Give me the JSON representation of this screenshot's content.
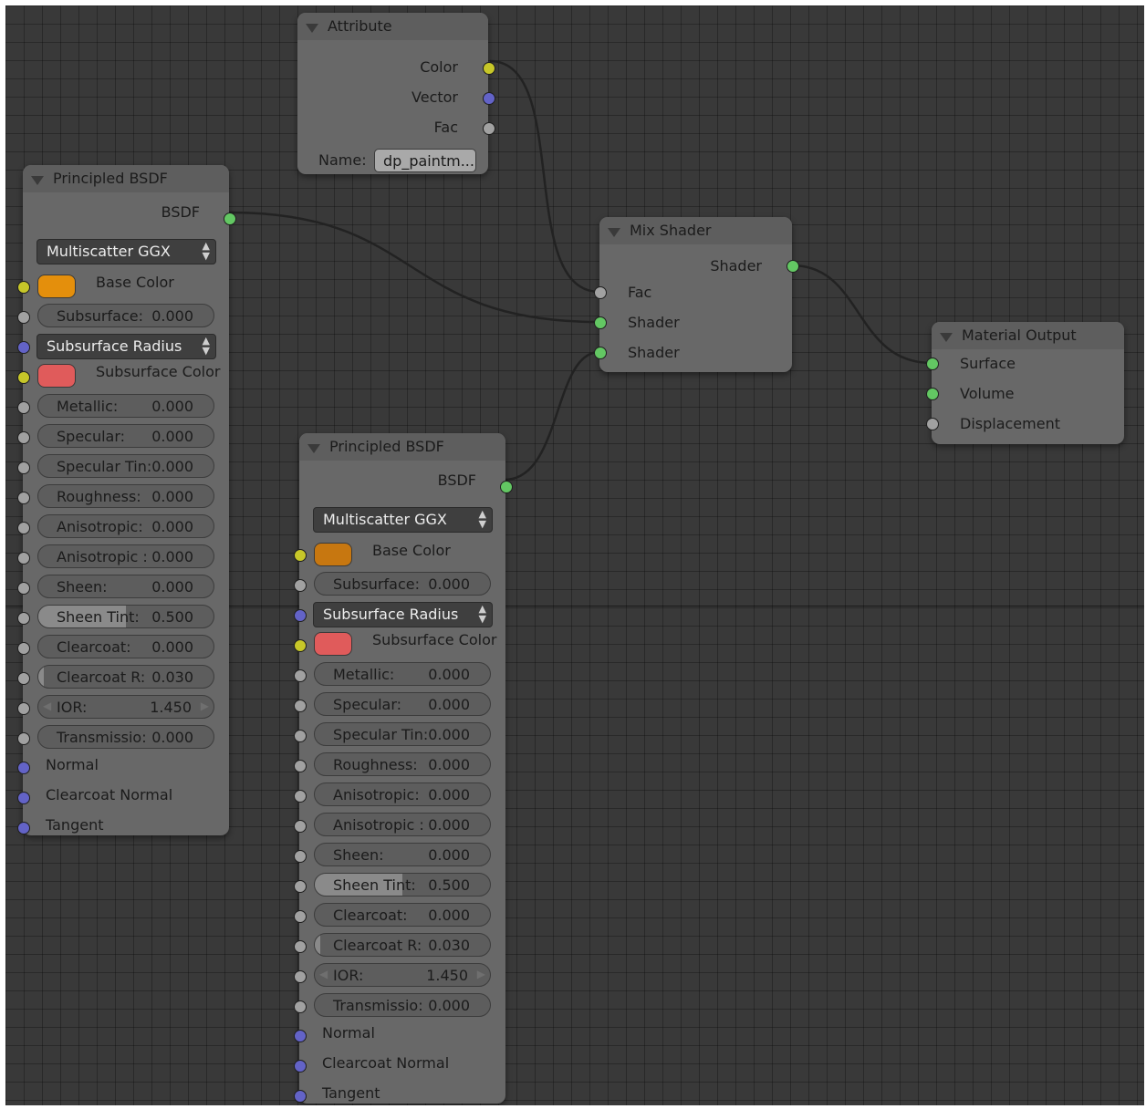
{
  "colors": {
    "background": "#393939",
    "node_body": "#686868",
    "socket_color": "#c7c729",
    "socket_vector": "#6363c7",
    "socket_float": "#a1a1a1",
    "socket_shader": "#63c763"
  },
  "attribute": {
    "title": "Attribute",
    "outputs": [
      "Color",
      "Vector",
      "Fac"
    ],
    "name_label": "Name:",
    "name_value": "dp_paintm..."
  },
  "mix_shader": {
    "title": "Mix Shader",
    "output": "Shader",
    "inputs": [
      "Fac",
      "Shader",
      "Shader"
    ]
  },
  "material_output": {
    "title": "Material Output",
    "inputs": [
      "Surface",
      "Volume",
      "Displacement"
    ]
  },
  "principled_1": {
    "title": "Principled BSDF",
    "output": "BSDF",
    "distribution": "Multiscatter GGX",
    "base_color": {
      "label": "Base Color",
      "swatch": "#e48f0c"
    },
    "subsurface_radius": "Subsurface Radius",
    "subsurface_color": {
      "label": "Subsurface Color",
      "swatch": "#e05b5b"
    },
    "fields": [
      {
        "label": "Subsurface:",
        "value": "0.000",
        "fraction": 0
      },
      {
        "label": "Metallic:",
        "value": "0.000",
        "fraction": 0
      },
      {
        "label": "Specular:",
        "value": "0.000",
        "fraction": 0
      },
      {
        "label": "Specular Tin:",
        "value": "0.000",
        "fraction": 0
      },
      {
        "label": "Roughness:",
        "value": "0.000",
        "fraction": 0
      },
      {
        "label": "Anisotropic:",
        "value": "0.000",
        "fraction": 0
      },
      {
        "label": "Anisotropic :",
        "value": "0.000",
        "fraction": 0
      },
      {
        "label": "Sheen:",
        "value": "0.000",
        "fraction": 0
      },
      {
        "label": "Sheen Tint:",
        "value": "0.500",
        "fraction": 0.5
      },
      {
        "label": "Clearcoat:",
        "value": "0.000",
        "fraction": 0
      },
      {
        "label": "Clearcoat R:",
        "value": "0.030",
        "fraction": 0.03
      },
      {
        "label": "IOR:",
        "value": "1.450",
        "fraction": 0
      },
      {
        "label": "Transmissio:",
        "value": "0.000",
        "fraction": 0
      }
    ],
    "vector_inputs": [
      "Normal",
      "Clearcoat Normal",
      "Tangent"
    ]
  },
  "principled_2": {
    "title": "Principled BSDF",
    "output": "BSDF",
    "distribution": "Multiscatter GGX",
    "base_color": {
      "label": "Base Color",
      "swatch": "#c77710"
    },
    "subsurface_radius": "Subsurface Radius",
    "subsurface_color": {
      "label": "Subsurface Color",
      "swatch": "#e05b5b"
    },
    "fields": [
      {
        "label": "Subsurface:",
        "value": "0.000",
        "fraction": 0
      },
      {
        "label": "Metallic:",
        "value": "0.000",
        "fraction": 0
      },
      {
        "label": "Specular:",
        "value": "0.000",
        "fraction": 0
      },
      {
        "label": "Specular Tin:",
        "value": "0.000",
        "fraction": 0
      },
      {
        "label": "Roughness:",
        "value": "0.000",
        "fraction": 0
      },
      {
        "label": "Anisotropic:",
        "value": "0.000",
        "fraction": 0
      },
      {
        "label": "Anisotropic :",
        "value": "0.000",
        "fraction": 0
      },
      {
        "label": "Sheen:",
        "value": "0.000",
        "fraction": 0
      },
      {
        "label": "Sheen Tint:",
        "value": "0.500",
        "fraction": 0.5
      },
      {
        "label": "Clearcoat:",
        "value": "0.000",
        "fraction": 0
      },
      {
        "label": "Clearcoat R:",
        "value": "0.030",
        "fraction": 0.03
      },
      {
        "label": "IOR:",
        "value": "1.450",
        "fraction": 0
      },
      {
        "label": "Transmissio:",
        "value": "0.000",
        "fraction": 0
      }
    ],
    "vector_inputs": [
      "Normal",
      "Clearcoat Normal",
      "Tangent"
    ]
  }
}
